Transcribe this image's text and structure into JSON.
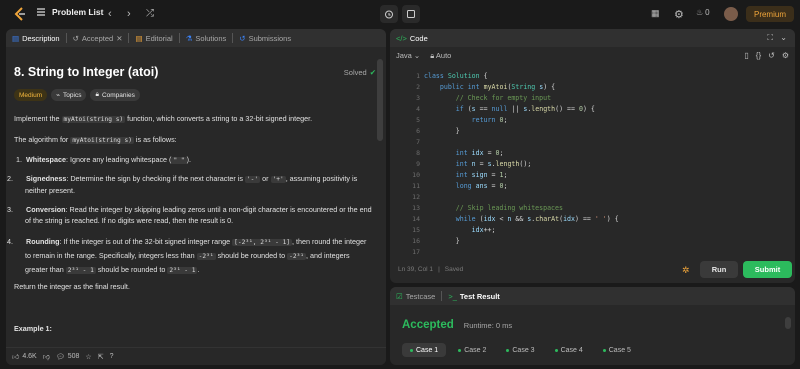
{
  "topbar": {
    "problem_list": "Problem List",
    "streak": "0",
    "premium": "Premium"
  },
  "desc": {
    "tabs": [
      "Description",
      "Accepted",
      "Editorial",
      "Solutions",
      "Submissions"
    ],
    "title": "8. String to Integer (atoi)",
    "solved": "Solved",
    "chips": [
      "Medium",
      "Topics",
      "Companies"
    ],
    "p1_a": "Implement the ",
    "p1_code": "myAtoi(string s)",
    "p1_b": " function, which converts a string to a 32-bit signed integer.",
    "p2_a": "The algorithm for ",
    "p2_code": "myAtoi(string s)",
    "p2_b": " is as follows:",
    "items": [
      {
        "num": "1.",
        "bold": "Whitespace",
        "text": ": Ignore any leading whitespace (",
        "code": "\" \"",
        "end": ")."
      },
      {
        "num": "2.",
        "bold": "Signedness",
        "text": ": Determine the sign by checking if the next character is ",
        "code": "'-'",
        "mid": " or ",
        "code2": "'+'",
        "end": ", assuming positivity is neither present."
      },
      {
        "num": "3.",
        "bold": "Conversion",
        "text": ": Read the integer by skipping leading zeros until a non-digit character is encountered or the end of the string is reached. If no digits were read, then the result is 0."
      },
      {
        "num": "4.",
        "bold": "Rounding",
        "text": ": If the integer is out of the 32-bit signed integer range ",
        "code": "[-2³¹, 2³¹ - 1]",
        "end": ", then round the integer to remain in the range. Specifically, integers less than ",
        "code2": "-2³¹",
        "end2": " should be rounded to ",
        "code3": "-2³¹",
        "end3": ", and integers greater than ",
        "code4": "2³¹ - 1",
        "end4": " should be rounded to ",
        "code5": "2³¹ - 1",
        "end5": "."
      }
    ],
    "return_text": "Return the integer as the final result.",
    "example": "Example 1:",
    "likes": "4.6K",
    "comments": "508"
  },
  "code": {
    "title": "Code",
    "language": "Java",
    "auto": "Auto",
    "status_pos": "Ln 39, Col 1",
    "status_saved": "Saved",
    "run": "Run",
    "submit": "Submit",
    "line_numbers": [
      "1",
      "2",
      "3",
      "4",
      "5",
      "6",
      "7",
      "8",
      "9",
      "10",
      "11",
      "12",
      "13",
      "14",
      "15",
      "16",
      "17"
    ]
  },
  "result": {
    "tabs": [
      "Testcase",
      "Test Result"
    ],
    "accepted": "Accepted",
    "runtime": "Runtime: 0 ms",
    "cases": [
      "Case 1",
      "Case 2",
      "Case 3",
      "Case 4",
      "Case 5"
    ]
  },
  "colors": {
    "accent_green": "#2cbb5d",
    "medium": "#f5b83d",
    "premium": "#f0a53a",
    "run_submit": "#2cbb5d"
  }
}
